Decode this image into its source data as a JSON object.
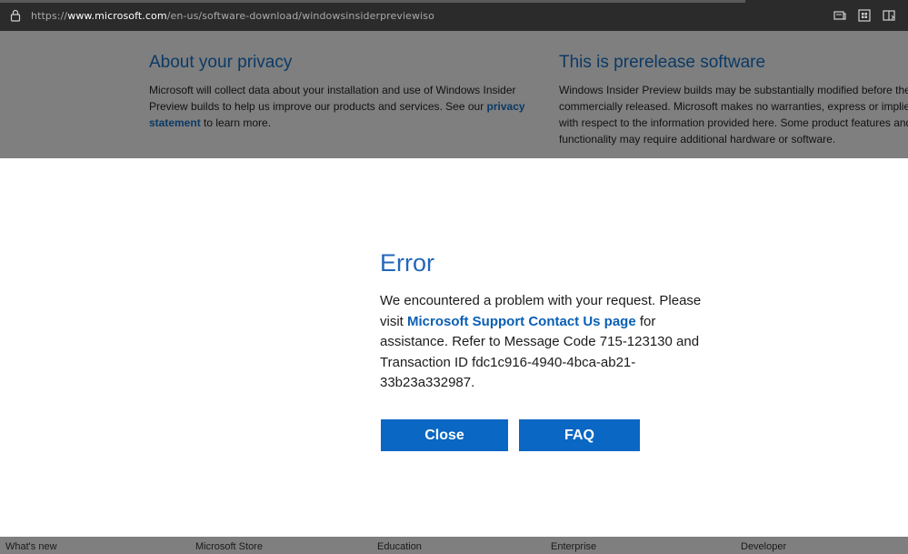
{
  "browser": {
    "url_prefix": "https://",
    "url_host": "www.microsoft.com",
    "url_path": "/en-us/software-download/windowsinsiderpreviewiso",
    "icons": [
      "lock-icon",
      "reader-view-icon",
      "apps-icon",
      "split-screen-icon"
    ]
  },
  "privacy": {
    "title": "About your privacy",
    "text_before": "Microsoft will collect data about your installation and use of Windows Insider Preview builds to help us improve our products and services. See our ",
    "link": "privacy statement",
    "text_after": " to learn more."
  },
  "prerelease": {
    "title": "This is prerelease software",
    "text": "Windows Insider Preview builds may be substantially modified before they are commercially released. Microsoft makes no warranties, express or implied, with respect to the information provided here. Some product features and functionality may require additional hardware or software."
  },
  "dialog": {
    "title": "Error",
    "msg_before": "We encountered a problem with your request. Please visit ",
    "msg_link": "Microsoft Support Contact Us page",
    "msg_after": " for assistance. Refer to Message Code 715-123130 and Transaction ID fdc1c916-4940-4bca-ab21-33b23a332987.",
    "close_label": "Close",
    "faq_label": "FAQ"
  },
  "footer": {
    "items": [
      "What's new",
      "Microsoft Store",
      "Education",
      "Enterprise",
      "Developer"
    ]
  },
  "colors": {
    "browser_bar": "#2b2b2b",
    "overlay": "#7f7f7f",
    "accent": "#0a67c3",
    "title_blue": "#2367b8"
  }
}
